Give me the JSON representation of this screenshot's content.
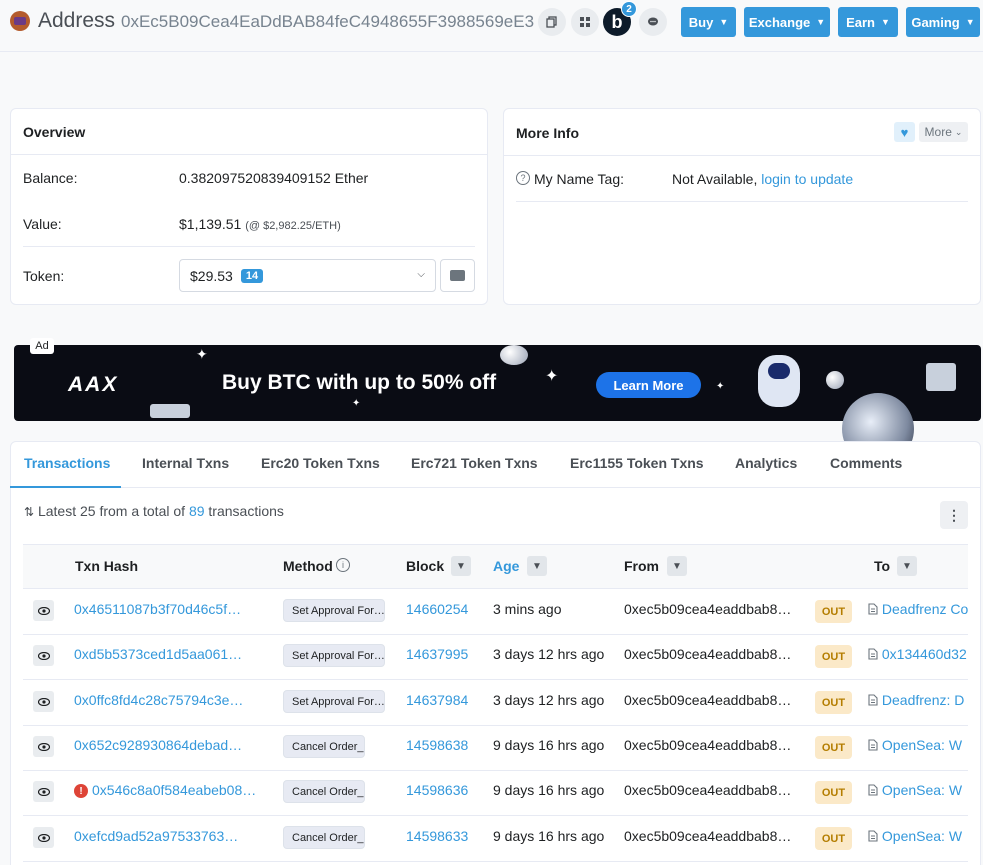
{
  "header": {
    "title": "Address",
    "address": "0xEc5B09Cea4EaDdBAB84feC4948655F3988569eE3",
    "blockscan_letter": "b",
    "blockscan_count": "2",
    "nav": [
      "Buy",
      "Exchange",
      "Earn",
      "Gaming"
    ]
  },
  "overview": {
    "title": "Overview",
    "balance_label": "Balance:",
    "balance_value": "0.382097520839409152 Ether",
    "value_label": "Value:",
    "value_usd": "$1,139.51",
    "value_rate": "(@ $2,982.25/ETH)",
    "token_label": "Token:",
    "token_value": "$29.53",
    "token_count": "14"
  },
  "more_info": {
    "title": "More Info",
    "more_label": "More",
    "name_tag_label": "My Name Tag:",
    "name_tag_value": "Not Available,",
    "name_tag_link": "login to update"
  },
  "ad": {
    "label": "Ad",
    "brand": "AAX",
    "headline": "Buy BTC with up to 50% off",
    "cta": "Learn More"
  },
  "tabs": [
    "Transactions",
    "Internal Txns",
    "Erc20 Token Txns",
    "Erc721 Token Txns",
    "Erc1155 Token Txns",
    "Analytics",
    "Comments"
  ],
  "summary": {
    "prefix": "Latest 25 from a total of",
    "count": "89",
    "suffix": "transactions"
  },
  "table": {
    "headers": {
      "hash": "Txn Hash",
      "method": "Method",
      "block": "Block",
      "age": "Age",
      "from": "From",
      "to": "To"
    },
    "rows": [
      {
        "hash": "0x46511087b3f70d46c5f…",
        "method": "Set Approval For…",
        "block": "14660254",
        "age": "3 mins ago",
        "from": "0xec5b09cea4eaddbab8…",
        "dir": "OUT",
        "to": "Deadfrenz Co",
        "error": false
      },
      {
        "hash": "0xd5b5373ced1d5aa061…",
        "method": "Set Approval For…",
        "block": "14637995",
        "age": "3 days 12 hrs ago",
        "from": "0xec5b09cea4eaddbab8…",
        "dir": "OUT",
        "to": "0x134460d32",
        "error": false
      },
      {
        "hash": "0x0ffc8fd4c28c75794c3e…",
        "method": "Set Approval For…",
        "block": "14637984",
        "age": "3 days 12 hrs ago",
        "from": "0xec5b09cea4eaddbab8…",
        "dir": "OUT",
        "to": "Deadfrenz: D",
        "error": false
      },
      {
        "hash": "0x652c928930864debad…",
        "method": "Cancel Order_",
        "block": "14598638",
        "age": "9 days 16 hrs ago",
        "from": "0xec5b09cea4eaddbab8…",
        "dir": "OUT",
        "to": "OpenSea: W",
        "error": false
      },
      {
        "hash": "0x546c8a0f584eabeb08…",
        "method": "Cancel Order_",
        "block": "14598636",
        "age": "9 days 16 hrs ago",
        "from": "0xec5b09cea4eaddbab8…",
        "dir": "OUT",
        "to": "OpenSea: W",
        "error": true
      },
      {
        "hash": "0xefcd9ad52a97533763…",
        "method": "Cancel Order_",
        "block": "14598633",
        "age": "9 days 16 hrs ago",
        "from": "0xec5b09cea4eaddbab8…",
        "dir": "OUT",
        "to": "OpenSea: W",
        "error": false
      }
    ]
  },
  "colors": {
    "accent": "#3498db",
    "out_bg": "#fbe9c8",
    "out_text": "#b47d00",
    "error": "#de4437"
  }
}
